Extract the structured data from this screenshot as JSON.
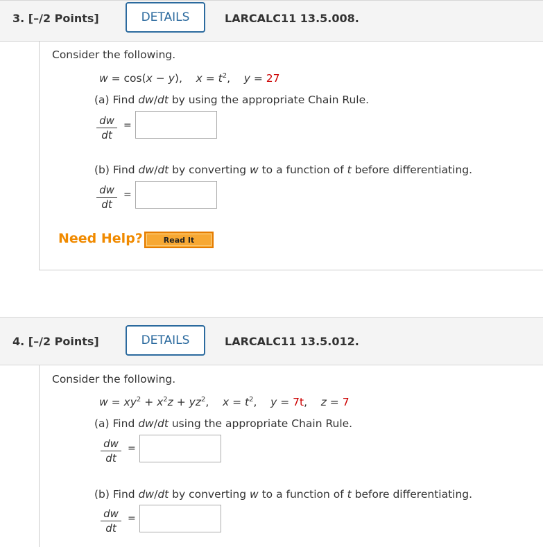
{
  "q3": {
    "points": "3.  [–/2 Points]",
    "details": "DETAILS",
    "code": "LARCALC11 13.5.008.",
    "intro": "Consider the following.",
    "eq_w": "w = cos(x − y),",
    "eq_x": "x = t",
    "eq_y_label": "y = ",
    "eq_y_val": "27",
    "part_a": "(a) Find dw/dt by using the appropriate Chain Rule.",
    "part_b": "(b) Find dw/dt by converting w to a function of t before differentiating.",
    "frac_num": "dw",
    "frac_den": "dt",
    "equals": "=",
    "help": "Need Help?",
    "read_it": "Read It"
  },
  "q4": {
    "points": "4.  [–/2 Points]",
    "details": "DETAILS",
    "code": "LARCALC11 13.5.012.",
    "intro": "Consider the following.",
    "part_a": "(a) Find dw/dt using the appropriate Chain Rule.",
    "part_b": "(b) Find dw/dt by converting w to a function of t before differentiating.",
    "frac_num": "dw",
    "frac_den": "dt",
    "equals": "=",
    "eq_y_val": "7t",
    "eq_z_val": "7"
  },
  "colors": {
    "accent": "#2b6a9e",
    "given_value": "#cc0000",
    "help": "#f08a00",
    "read_it_button": "#f7a833"
  }
}
